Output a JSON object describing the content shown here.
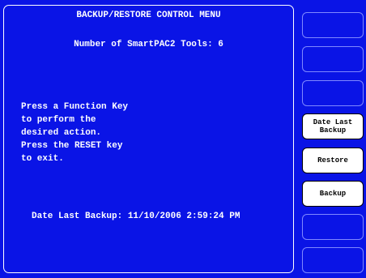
{
  "colors": {
    "screen_background": "#0a14e6",
    "text": "#ffffff",
    "active_key_background": "#ffffff",
    "inactive_key_border": "#7f88ff"
  },
  "menu": {
    "title": "BACKUP/RESTORE CONTROL MENU",
    "tools_count_line": "Number of SmartPAC2 Tools: 6",
    "instructions": [
      "Press a Function Key",
      "to perform the",
      "desired action.",
      "Press the RESET key",
      "to exit."
    ],
    "last_backup_line": "Date Last Backup: 11/10/2006 2:59:24 PM"
  },
  "function_keys": [
    {
      "label": "",
      "active": false
    },
    {
      "label": "",
      "active": false
    },
    {
      "label": "",
      "active": false
    },
    {
      "label": "Date Last\nBackup",
      "active": true
    },
    {
      "label": "Restore",
      "active": true
    },
    {
      "label": "Backup",
      "active": true
    },
    {
      "label": "",
      "active": false
    },
    {
      "label": "",
      "active": false
    }
  ]
}
